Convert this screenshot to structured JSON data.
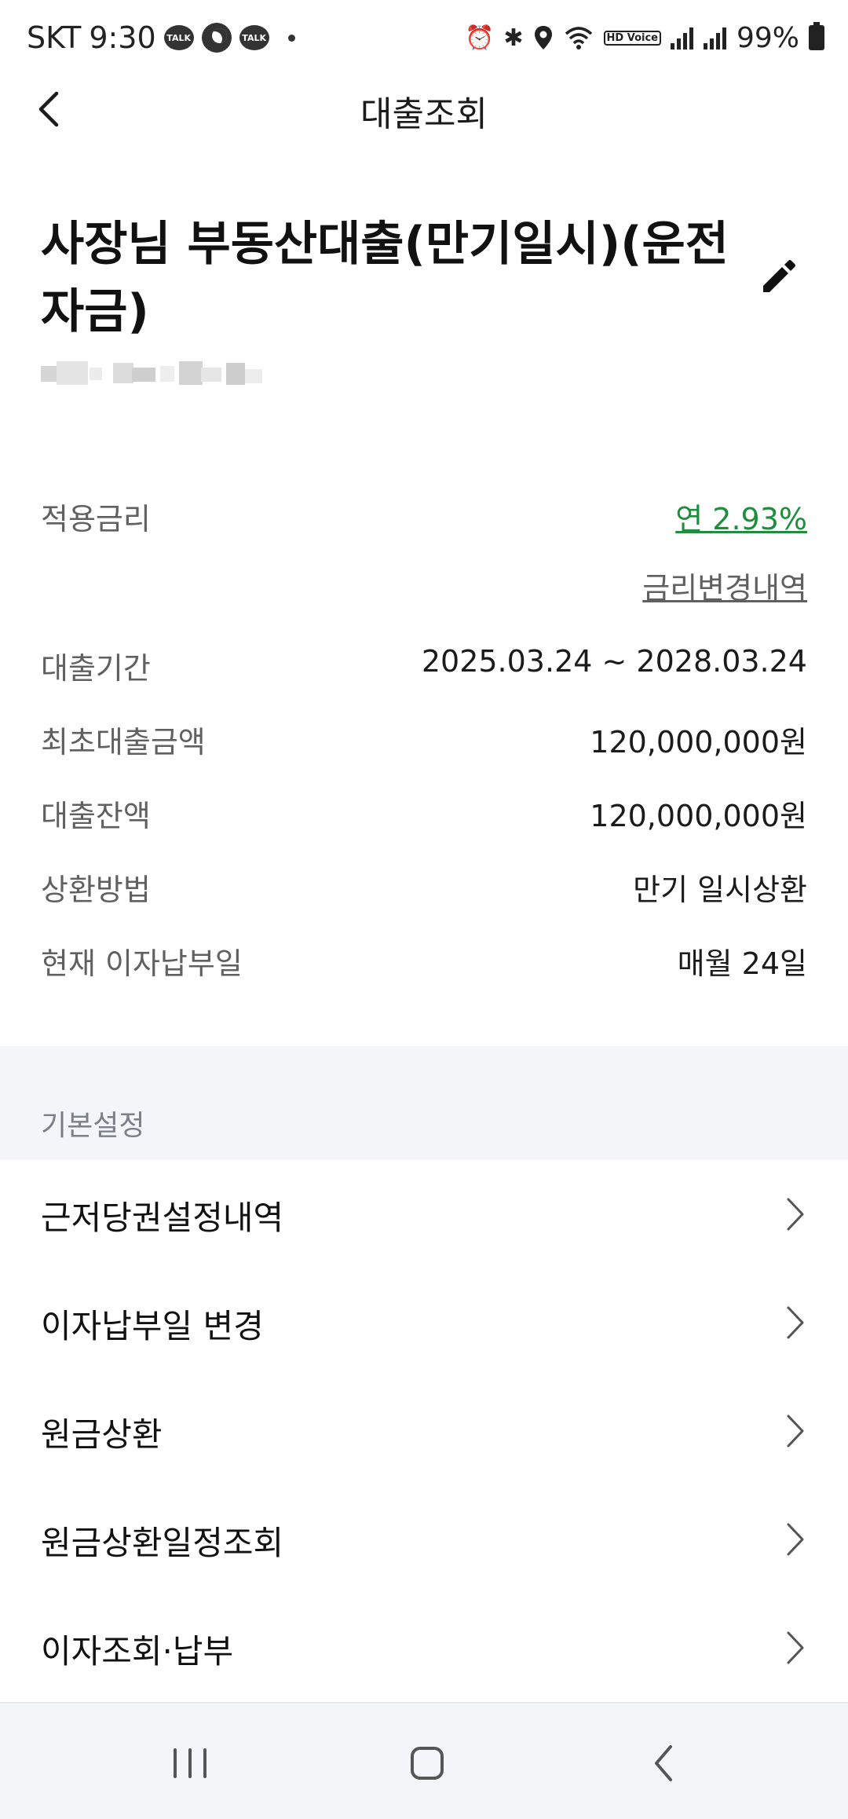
{
  "status_bar": {
    "carrier": "SKT",
    "time": "9:30",
    "talk_badge_1": "TALK",
    "talk_badge_2": "TALK",
    "hd_voice": "HD Voice",
    "battery": "99%"
  },
  "header": {
    "title": "대출조회"
  },
  "loan": {
    "title": "사장님 부동산대출(만기일시)(운전자금)"
  },
  "details": {
    "rate_label": "적용금리",
    "rate_value": "연 2.93%",
    "rate_history_link": "금리변경내역",
    "period_label": "대출기간",
    "period_value": "2025.03.24 ~ 2028.03.24",
    "initial_amount_label": "최초대출금액",
    "initial_amount_value": "120,000,000원",
    "balance_label": "대출잔액",
    "balance_value": "120,000,000원",
    "repayment_label": "상환방법",
    "repayment_value": "만기 일시상환",
    "interest_day_label": "현재 이자납부일",
    "interest_day_value": "매월 24일"
  },
  "section": {
    "title": "기본설정"
  },
  "menu": [
    {
      "label": "근저당권설정내역"
    },
    {
      "label": "이자납부일 변경"
    },
    {
      "label": "원금상환"
    },
    {
      "label": "원금상환일정조회"
    },
    {
      "label": "이자조회·납부"
    }
  ],
  "colors": {
    "accent_green": "#1e8e3e",
    "section_bg": "#f4f5f9",
    "label_gray": "#606060"
  }
}
